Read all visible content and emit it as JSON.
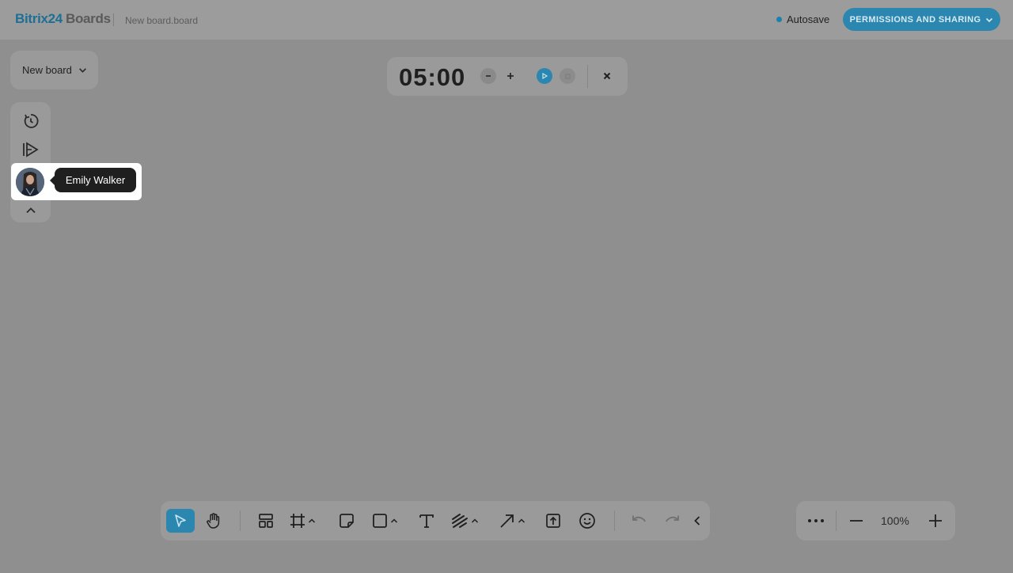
{
  "header": {
    "logo_brand": "Bitrix24",
    "logo_product": "Boards",
    "board_file": "New board.board",
    "autosave_label": "Autosave",
    "permissions_label": "PERMISSIONS AND SHARING"
  },
  "board_selector": {
    "label": "New board"
  },
  "timer": {
    "display": "05:00"
  },
  "sidebar": {
    "icons": [
      "timer-icon",
      "follow-presenter-icon",
      "avatar",
      "collapse-icon"
    ],
    "tooltip": "Emily Walker"
  },
  "toolbar": {
    "tools": [
      "select",
      "hand",
      "templates",
      "frame",
      "sticky-note",
      "shape",
      "text",
      "pen",
      "arrow",
      "upload",
      "emoji",
      "undo",
      "redo",
      "collapse"
    ]
  },
  "zoom": {
    "level": "100%"
  },
  "colors": {
    "accent": "#2b86b0",
    "overlay_bg": "#8f8f8f",
    "tooltip_bg": "#1f1f1f"
  }
}
